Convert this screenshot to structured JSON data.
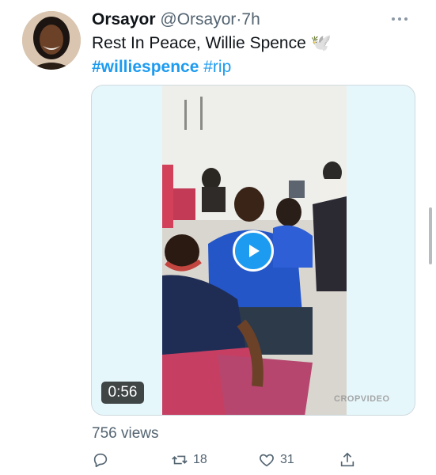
{
  "tweet": {
    "display_name": "Orsayor",
    "handle": "@Orsayor",
    "separator": "·",
    "time": "7h",
    "text": "Rest In Peace, Willie Spence 🕊️",
    "hashtags": [
      "#williespence",
      "#rip"
    ],
    "media": {
      "type": "video",
      "duration": "0:56",
      "watermark": "CROPVIDEO"
    },
    "views": "756 views",
    "actions": {
      "reply_icon": "reply-icon",
      "retweet_icon": "retweet-icon",
      "retweet_count": "18",
      "like_icon": "heart-icon",
      "like_count": "31",
      "share_icon": "share-icon"
    }
  },
  "colors": {
    "accent": "#1d9bf0",
    "text_primary": "#0f1419",
    "text_secondary": "#536471",
    "media_background": "#e6f7fb"
  }
}
